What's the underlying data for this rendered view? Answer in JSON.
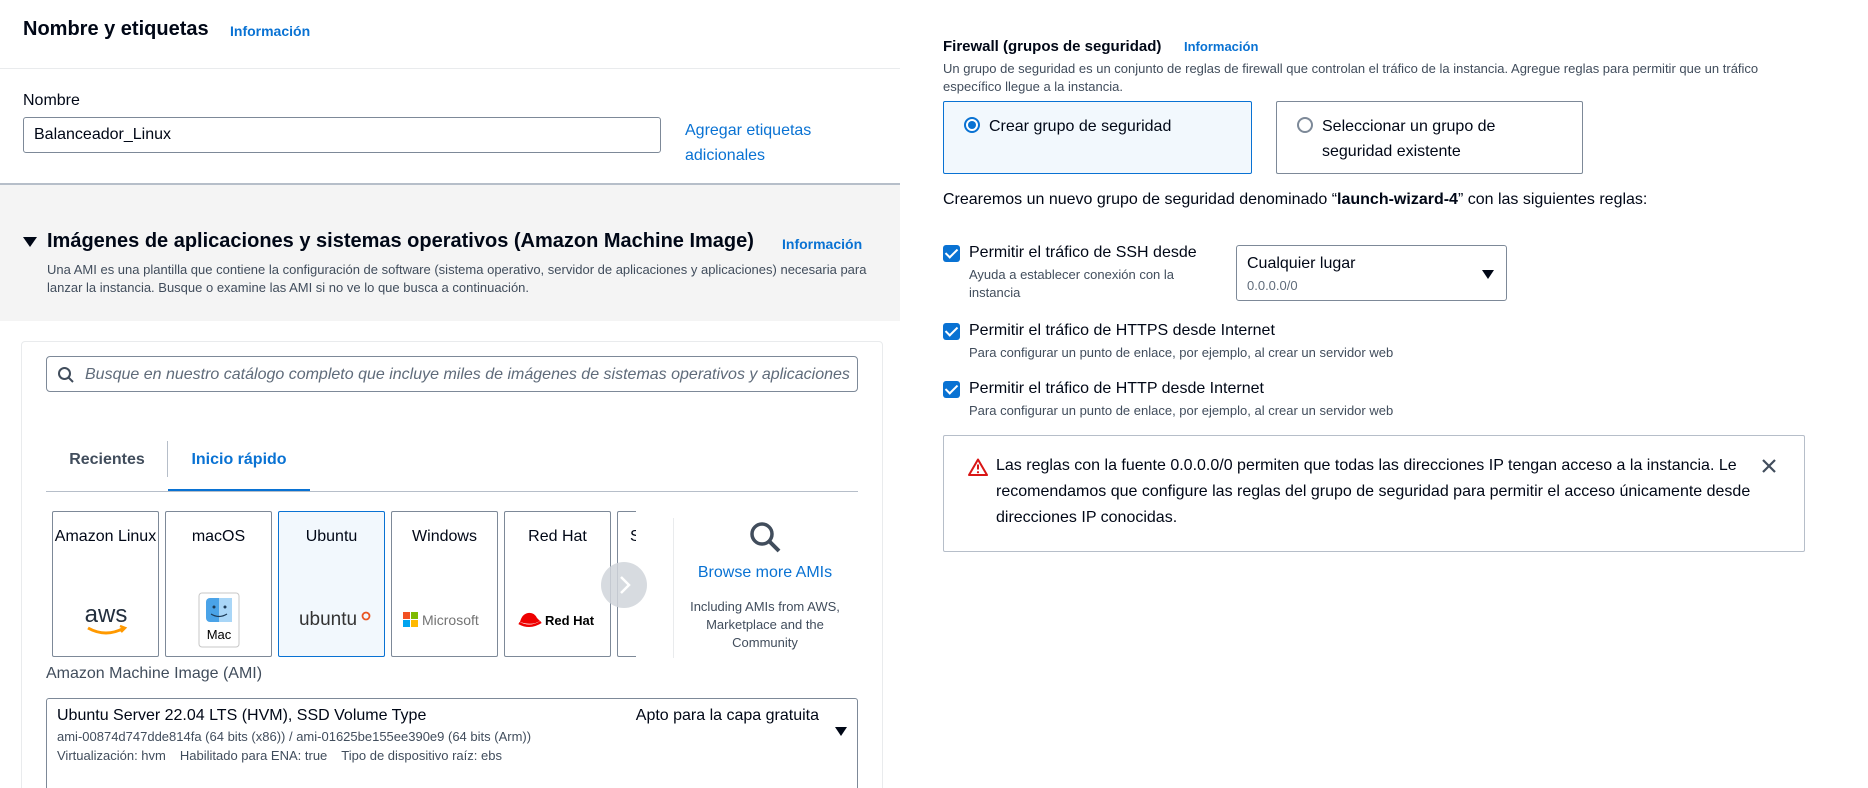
{
  "name_section": {
    "title": "Nombre y etiquetas",
    "info": "Información",
    "name_label": "Nombre",
    "name_value": "Balanceador_Linux",
    "add_tags": "Agregar etiquetas adicionales"
  },
  "ami_section": {
    "title": "Imágenes de aplicaciones y sistemas operativos (Amazon Machine Image)",
    "info": "Información",
    "description": "Una AMI es una plantilla que contiene la configuración de software (sistema operativo, servidor de aplicaciones y aplicaciones) necesaria para lanzar la instancia. Busque o examine las AMI si no ve lo que busca a continuación.",
    "search_placeholder": "Busque en nuestro catálogo completo que incluye miles de imágenes de sistemas operativos y aplicaciones",
    "tabs": [
      {
        "label": "Recientes",
        "active": false
      },
      {
        "label": "Inicio rápido",
        "active": true
      }
    ],
    "tiles": [
      {
        "name": "Amazon Linux",
        "logo": "aws-logo",
        "logo_text": "aws",
        "selected": false
      },
      {
        "name": "macOS",
        "logo": "mac-finder-icon",
        "logo_text": "Mac",
        "selected": false
      },
      {
        "name": "Ubuntu",
        "logo": "ubuntu-logo",
        "logo_text": "ubuntu",
        "selected": true
      },
      {
        "name": "Windows",
        "logo": "microsoft-logo",
        "logo_text": "Microsoft",
        "selected": false
      },
      {
        "name": "Red Hat",
        "logo": "redhat-logo",
        "logo_text": "Red Hat",
        "selected": false
      },
      {
        "name": "S",
        "logo": "",
        "logo_text": "",
        "selected": false
      }
    ],
    "browse_more": "Browse more AMIs",
    "browse_sub": "Including AMIs from AWS, Marketplace and the Community",
    "ami_label": "Amazon Machine Image (AMI)",
    "selected_ami": {
      "name": "Ubuntu Server 22.04 LTS (HVM), SSD Volume Type",
      "tier": "Apto para la capa gratuita",
      "ids": "ami-00874d747dde814fa (64 bits (x86)) / ami-01625be155ee390e9 (64 bits (Arm))",
      "virtualization": "Virtualización: hvm",
      "ena": "Habilitado para ENA: true",
      "root_device": "Tipo de dispositivo raíz: ebs"
    }
  },
  "firewall": {
    "title": "Firewall (grupos de seguridad)",
    "info": "Información",
    "description": "Un grupo de seguridad es un conjunto de reglas de firewall que controlan el tráfico de la instancia. Agregue reglas para permitir que un tráfico específico llegue a la instancia.",
    "option_create": "Crear grupo de seguridad",
    "option_existing": "Seleccionar un grupo de seguridad existente",
    "selected_option": "create",
    "create_msg_prefix": "Crearemos un nuevo grupo de seguridad denominado “",
    "group_name": "launch-wizard-4",
    "create_msg_suffix": "” con las siguientes reglas:",
    "rules": [
      {
        "label": "Permitir el tráfico de SSH desde",
        "sub": "Ayuda a establecer conexión con la instancia",
        "checked": true
      },
      {
        "label": "Permitir el tráfico de HTTPS desde Internet",
        "sub": "Para configurar un punto de enlace, por ejemplo, al crear un servidor web",
        "checked": true
      },
      {
        "label": "Permitir el tráfico de HTTP desde Internet",
        "sub": "Para configurar un punto de enlace, por ejemplo, al crear un servidor web",
        "checked": true
      }
    ],
    "ssh_source": {
      "main": "Cualquier lugar",
      "sub": "0.0.0.0/0"
    },
    "warning": "Las reglas con la fuente 0.0.0.0/0 permiten que todas las direcciones IP tengan acceso a la instancia. Le recomendamos que configure las reglas del grupo de seguridad para permitir el acceso únicamente desde direcciones IP conocidas."
  },
  "colors": {
    "link": "#0972d3",
    "text": "#000716",
    "warning": "#d91515",
    "selected_bg": "#f2f8fd"
  }
}
